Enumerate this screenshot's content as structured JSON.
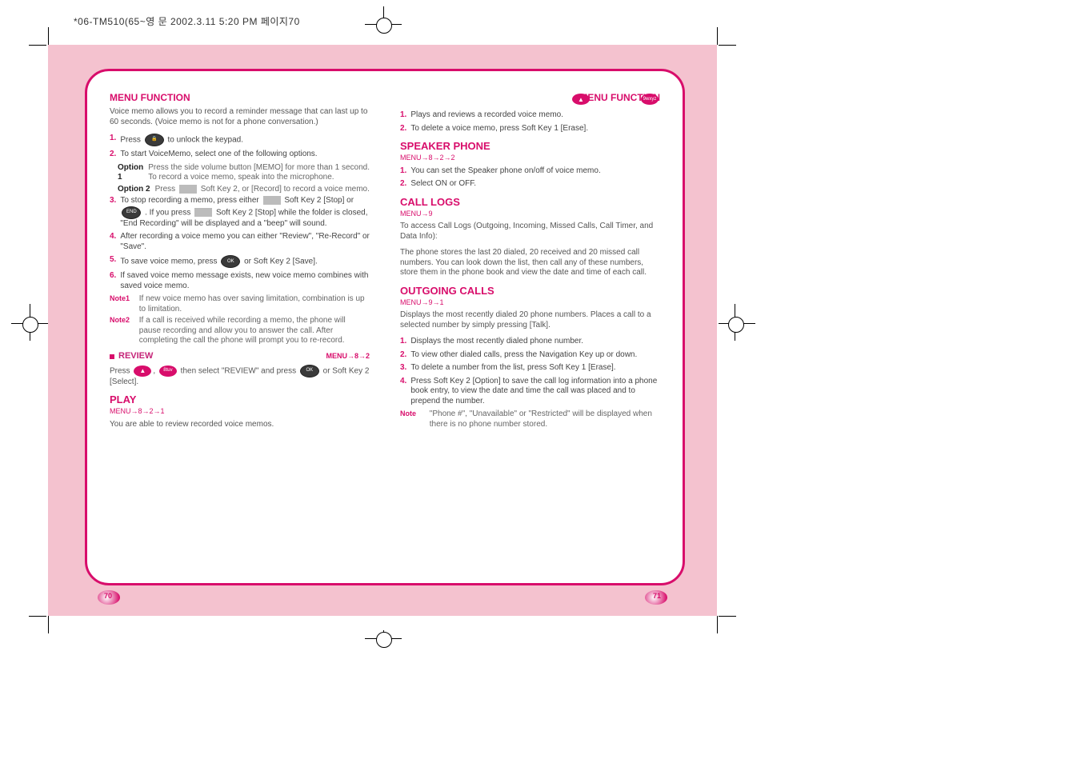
{
  "header_slug": "*06-TM510(65~영 문  2002.3.11 5:20 PM  페이지70",
  "left": {
    "title": "MENU FUNCTION",
    "intro": "Voice memo allows you to record a reminder message that can last up to 60 seconds. (Voice memo is not for a phone conversation.)",
    "steps": [
      {
        "n": "1.",
        "text_a": "Press ",
        "icon": "lock",
        "text_b": " to unlock the keypad."
      },
      {
        "n": "2.",
        "text_a": "To start VoiceMemo, select one of the following options.",
        "text_b": ""
      }
    ],
    "options": [
      {
        "head": "Option 1",
        "body": "Press the side volume button [MEMO] for more than 1 second. To record a voice memo, speak into the microphone."
      },
      {
        "head": "Option 2",
        "body": "Press  Soft Key 2, or [Record] to record a voice memo."
      }
    ],
    "step3": {
      "n": "3.",
      "text": "To stop recording a memo, press either  Soft Key 2 [Stop] or  . If you press  Soft Key 2 [Stop] while the folder is closed, \"End Recording\" will be displayed and a \"beep\" will sound."
    },
    "step4": {
      "n": "4.",
      "text": "After recording a voice memo you can either \"Review\", \"Re-Record\" or \"Save\"."
    },
    "step5": {
      "n": "5.",
      "text": "To save voice memo, press  or Soft Key 2 [Save]."
    },
    "step6": {
      "n": "6.",
      "text": "If saved voice memo message exists, new voice memo combines with saved voice memo."
    },
    "notes": [
      {
        "label": "Note1",
        "text": "If new voice memo has over saving limitation, combination is up to limitation."
      },
      {
        "label": "Note2",
        "text": "If a call is received while recording a memo, the phone will pause recording and allow you to answer the call. After completing the call the phone will prompt you to re-record."
      }
    ],
    "play_section": {
      "pretext": "Press  ,  then select \"REVIEW\" and press  or Soft Key 2 [Select].",
      "header_title": "PLAY",
      "header_num": "MENU→8→2→1",
      "desc": "You are able to review recorded voice memos."
    },
    "page_number": "70"
  },
  "right": {
    "title": "MENU FUNCTION",
    "key_row": [
      "▲",
      "9wxyz"
    ],
    "intro_steps": [
      {
        "n": "1.",
        "text": "Plays and reviews a recorded voice memo."
      },
      {
        "n": "2.",
        "text": "To delete a voice memo, press Soft Key 1 [Erase]."
      }
    ],
    "sp_title": "SPEAKER PHONE",
    "sp_num": "MENU→8→2→2",
    "sp_items": [
      {
        "n": "1.",
        "text": "You can set the Speaker phone on/off of voice memo."
      },
      {
        "n": "2.",
        "text": "Select ON or OFF."
      }
    ],
    "cl_title": "CALL LOGS",
    "cl_num": "MENU→9",
    "cl_desc1": "To access Call Logs (Outgoing, Incoming, Missed Calls, Call Timer, and Data Info):",
    "cl_desc2": "The phone stores the last 20 dialed, 20 received and 20 missed call numbers. You can look down the list, then call any of these numbers, store them in the phone book and view the date and time of each call.",
    "out_title": "OUTGOING CALLS",
    "out_num": "MENU→9→1",
    "out_desc": "Displays the most recently dialed 20 phone numbers. Places a call to a selected number by simply pressing [Talk].",
    "out_steps": [
      {
        "n": "1.",
        "text": "Displays the most recently dialed phone number."
      },
      {
        "n": "2.",
        "text": "To view other dialed calls, press the Navigation Key up or down."
      },
      {
        "n": "3.",
        "text": "To delete a number from the list, press Soft Key 1 [Erase]."
      },
      {
        "n": "4.",
        "text": "Press Soft Key 2 [Option] to save the call log information into a phone book entry, to view the date and time the call was placed and to prepend the number."
      }
    ],
    "out_note": "\"Phone #\", \"Unavailable\" or \"Restricted\" will be displayed when there is no phone number stored.",
    "page_number": "71"
  }
}
